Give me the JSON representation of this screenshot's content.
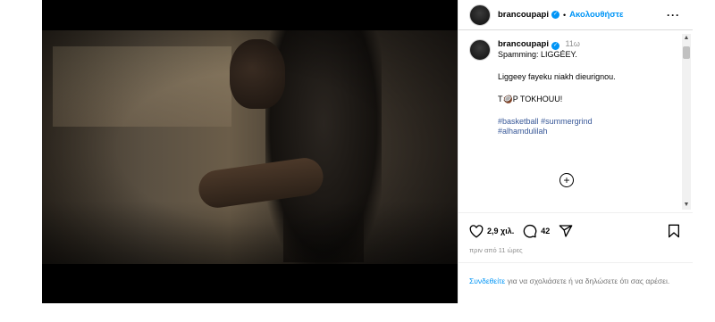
{
  "post": {
    "username": "brancoupapi",
    "follow_label": "Ακολουθήστε",
    "dot": "•",
    "more": "···"
  },
  "caption": {
    "username": "brancoupapi",
    "time": "11ω",
    "line1": "Spamming: LIGGÉEY.",
    "line2": "Liggeey fayeku niakh dieurignou.",
    "line3": "T🥥P TOKHOUU!",
    "hashtags": [
      "#basketball",
      "#summergrind",
      "#alhamdulilah"
    ]
  },
  "stats": {
    "likes": "2,9 χιλ.",
    "comments": "42",
    "posted_ago": "πριν από 11 ώρες"
  },
  "login_prompt": {
    "link": "Συνδεθείτε",
    "text": " για να σχολιάσετε ή να δηλώσετε ότι σας αρέσει."
  },
  "icons": {
    "mute": "speaker-muted-icon",
    "verified": "verified-badge-icon",
    "more": "more-options-icon",
    "add": "plus-circle-icon",
    "like": "heart-icon",
    "comment": "comment-bubble-icon",
    "share": "paper-plane-icon",
    "save": "bookmark-icon"
  },
  "colors": {
    "accent": "#0095f6",
    "hashtag": "#385898",
    "muted": "#8e8e8e"
  }
}
